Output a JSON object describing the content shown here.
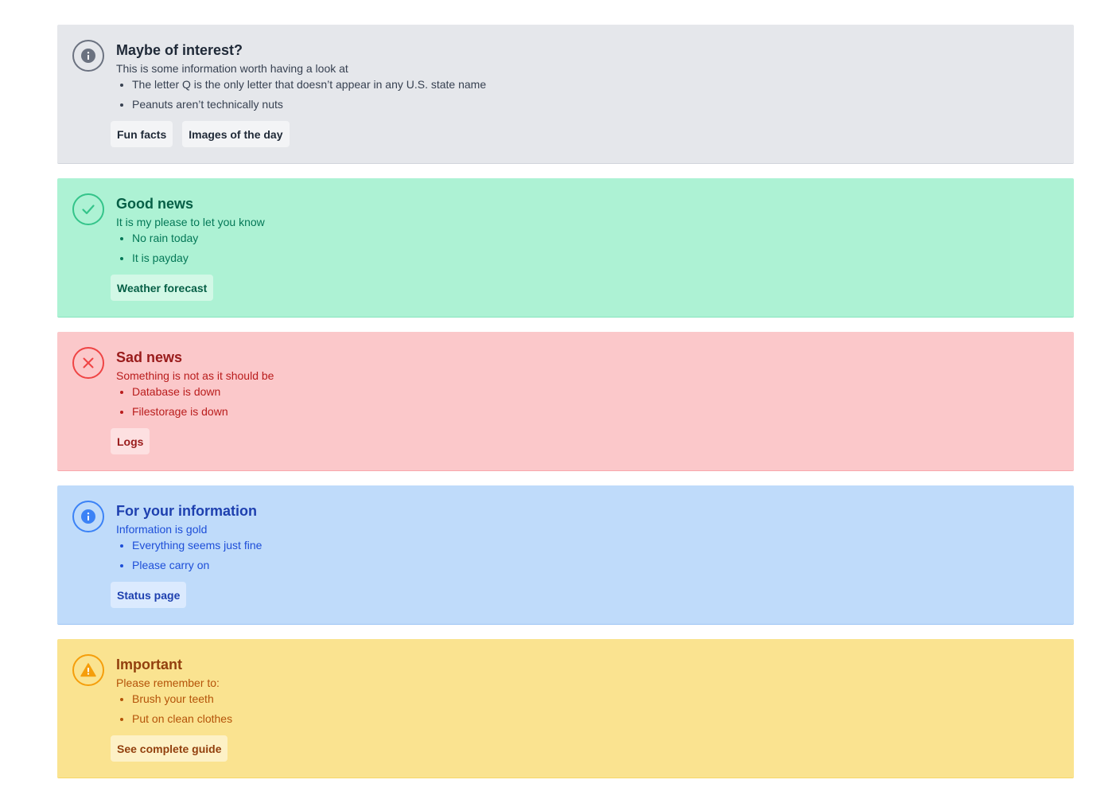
{
  "alerts": [
    {
      "variant": "neutral",
      "icon": "info-circle-icon",
      "accent": "#6b7280",
      "title": "Maybe of interest?",
      "description": "This is some information worth having a look at",
      "items": [
        "The letter Q is the only letter that doesn’t appear in any U.S. state name",
        "Peanuts aren’t technically nuts"
      ],
      "actions": [
        "Fun facts",
        "Images of the day"
      ]
    },
    {
      "variant": "success",
      "icon": "check-circle-icon",
      "accent": "#34c48a",
      "title": "Good news",
      "description": "It is my please to let you know",
      "items": [
        "No rain today",
        "It is payday"
      ],
      "actions": [
        "Weather forecast"
      ]
    },
    {
      "variant": "danger",
      "icon": "x-circle-icon",
      "accent": "#ef4444",
      "title": "Sad news",
      "description": "Something is not as it should be",
      "items": [
        "Database is down",
        "Filestorage is down"
      ],
      "actions": [
        "Logs"
      ]
    },
    {
      "variant": "info",
      "icon": "info-circle-icon",
      "accent": "#3b82f6",
      "title": "For your information",
      "description": "Information is gold",
      "items": [
        "Everything seems just fine",
        "Please carry on"
      ],
      "actions": [
        "Status page"
      ]
    },
    {
      "variant": "warning",
      "icon": "warning-triangle-icon",
      "accent": "#f59e0b",
      "title": "Important",
      "description": "Please remember to:",
      "items": [
        "Brush your teeth",
        "Put on clean clothes"
      ],
      "actions": [
        "See complete guide"
      ]
    }
  ]
}
